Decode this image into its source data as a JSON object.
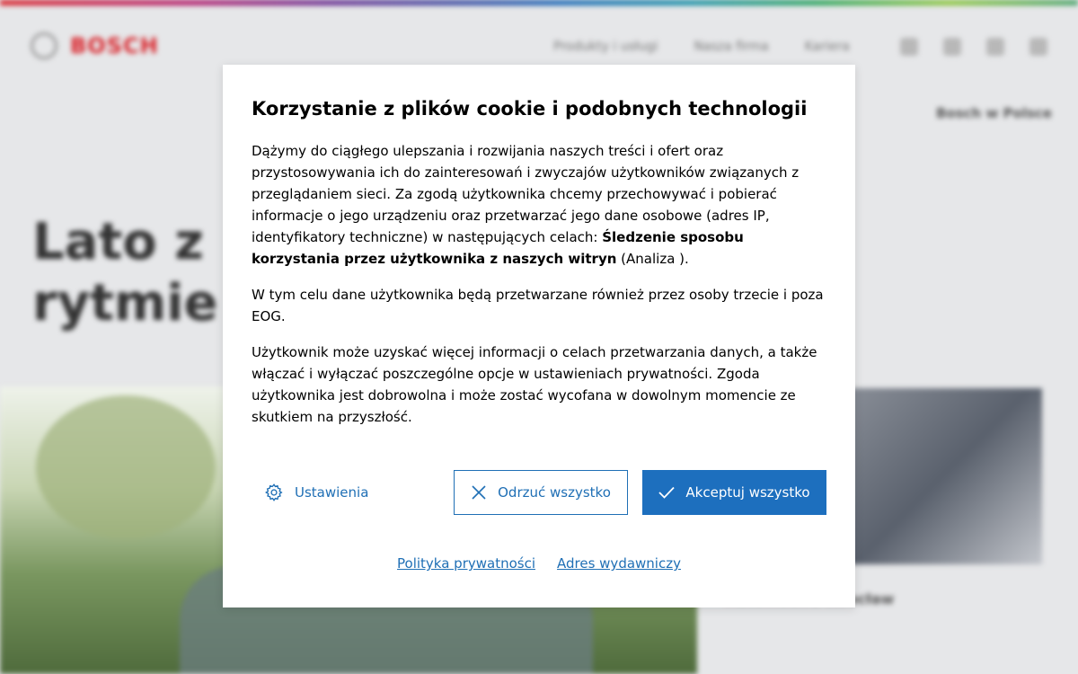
{
  "background": {
    "brand": "BOSCH",
    "nav": [
      "Produkty i usługi",
      "Nasza firma",
      "Kariera"
    ],
    "region": "Bosch w Polsce",
    "hero_line1": "Lato z",
    "hero_line2": "rytmie",
    "side_text": "Automotive Wrocław",
    "side_link": ""
  },
  "cookie_modal": {
    "title": "Korzystanie z plików cookie i podobnych technologii",
    "p1_text": "Dążymy do ciągłego ulepszania i rozwijania naszych treści i ofert oraz przystosowywania ich do zainteresowań i zwyczajów użytkowników związanych z przeglądaniem sieci. Za zgodą użytkownika chcemy przechowywać i pobierać informacje o jego urządzeniu oraz przetwarzać jego dane osobowe (adres IP, identyfikatory techniczne) w następujących celach: ",
    "p1_bold": "Śledzenie sposobu korzystania przez użytkownika z naszych witryn",
    "p1_tail": " (Analiza ).",
    "p2": "W tym celu dane użytkownika będą przetwarzane również przez osoby trzecie i poza EOG.",
    "p3": "Użytkownik może uzyskać więcej informacji o celach przetwarzania danych, a także włączać i wyłączać poszczególne opcje w ustawieniach prywatności. Zgoda użytkownika jest dobrowolna i może zostać wycofana w dowolnym momencie ze skutkiem na przyszłość.",
    "settings_label": "Ustawienia",
    "settings_icon": "gear-icon",
    "reject_label": "Odrzuć wszystko",
    "reject_icon": "close-icon",
    "accept_label": "Akceptuj wszystko",
    "accept_icon": "checkmark-icon",
    "privacy_link": "Polityka prywatności",
    "imprint_link": "Adres wydawniczy"
  },
  "colors": {
    "accent": "#1d6fbe",
    "brand_red": "#d9232a"
  }
}
